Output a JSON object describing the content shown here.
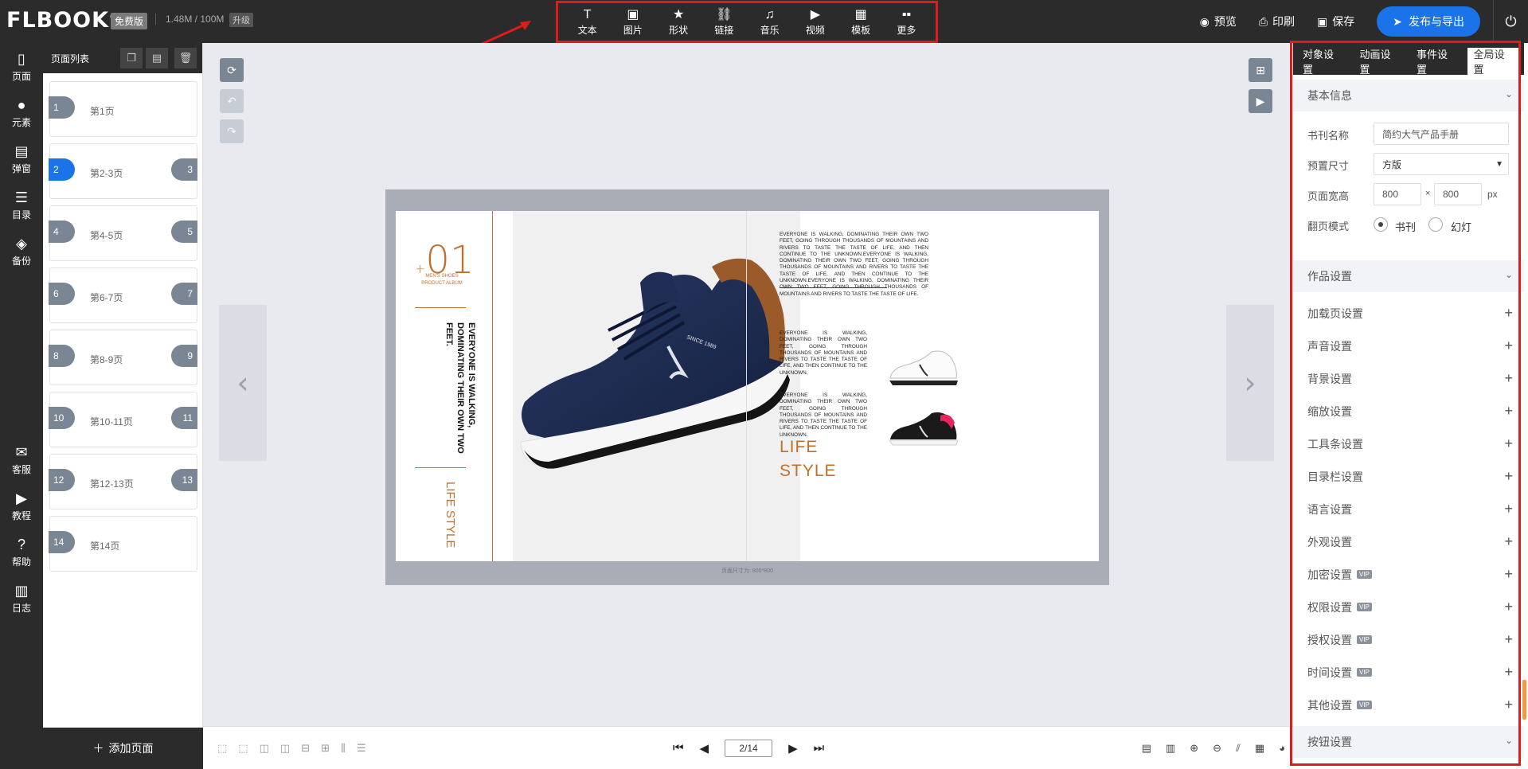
{
  "topbar": {
    "logo": "FLBOOK",
    "logo_mark": "®",
    "plan_badge": "免费版",
    "storage": "1.48M / 100M",
    "upgrade": "升级",
    "tools": [
      {
        "icon": "text-icon",
        "glyph": "T",
        "label": "文本"
      },
      {
        "icon": "image-icon",
        "glyph": "▣",
        "label": "图片"
      },
      {
        "icon": "star-icon",
        "glyph": "★",
        "label": "形状"
      },
      {
        "icon": "link-icon",
        "glyph": "⛓",
        "label": "链接"
      },
      {
        "icon": "music-icon",
        "glyph": "♫",
        "label": "音乐"
      },
      {
        "icon": "play-icon",
        "glyph": "▶",
        "label": "视频"
      },
      {
        "icon": "template-icon",
        "glyph": "▦",
        "label": "模板"
      },
      {
        "icon": "more-icon",
        "glyph": "▪▪",
        "label": "更多"
      }
    ],
    "preview": "预览",
    "print": "印刷",
    "save": "保存",
    "publish": "发布与导出"
  },
  "leftnav": [
    {
      "icon": "page-icon",
      "glyph": "▯",
      "label": "页面"
    },
    {
      "icon": "elements-icon",
      "glyph": "●",
      "label": "元素"
    },
    {
      "icon": "popup-icon",
      "glyph": "▤",
      "label": "弹窗"
    },
    {
      "icon": "toc-icon",
      "glyph": "☰",
      "label": "目录"
    },
    {
      "icon": "backup-icon",
      "glyph": "◈",
      "label": "备份"
    },
    {
      "icon": "service-icon",
      "glyph": "✉",
      "label": "客服"
    },
    {
      "icon": "tutorial-icon",
      "glyph": "▶",
      "label": "教程"
    },
    {
      "icon": "help-icon",
      "glyph": "?",
      "label": "帮助"
    },
    {
      "icon": "log-icon",
      "glyph": "▥",
      "label": "日志"
    }
  ],
  "pagelist": {
    "title": "页面列表",
    "items": [
      {
        "n1": "1",
        "n2": "",
        "label": "第1页",
        "active": false
      },
      {
        "n1": "2",
        "n2": "3",
        "label": "第2-3页",
        "active": true
      },
      {
        "n1": "4",
        "n2": "5",
        "label": "第4-5页",
        "active": false
      },
      {
        "n1": "6",
        "n2": "7",
        "label": "第6-7页",
        "active": false
      },
      {
        "n1": "8",
        "n2": "9",
        "label": "第8-9页",
        "active": false
      },
      {
        "n1": "10",
        "n2": "11",
        "label": "第10-11页",
        "active": false
      },
      {
        "n1": "12",
        "n2": "13",
        "label": "第12-13页",
        "active": false
      },
      {
        "n1": "14",
        "n2": "",
        "label": "第14页",
        "active": false
      }
    ],
    "add_page": "添加页面"
  },
  "book": {
    "number": "01",
    "number_prefix": "+",
    "small": "MEN'S SHOES PRODUCT ALBUM",
    "vertical_text": "EVERYONE IS WALKING, DOMINATING THEIR OWN TWO FEET.",
    "vertical_life": "LIFE STYLE",
    "para1": "EVERYONE IS WALKING, DOMINATING THEIR OWN TWO FEET, GOING THROUGH THOUSANDS OF MOUNTAINS AND RIVERS TO TASTE THE TASTE OF LIFE, AND THEN CONTINUE TO THE UNKNOWN.EVERYONE IS WALKING, DOMINATING THEIR OWN TWO FEET, GOING THROUGH THOUSANDS OF MOUNTAINS AND RIVERS TO TASTE THE TASTE OF LIFE, AND THEN CONTINUE TO THE UNKNOWN.EVERYONE IS WALKING, DOMINATING THEIR OWN TWO FEET, GOING THROUGH THOUSANDS OF MOUNTAINS AND RIVERS TO TASTE THE TASTE OF LIFE.",
    "para2": "EVERYONE IS WALKING, DOMINATING THEIR OWN TWO FEET, GOING THROUGH THOUSANDS OF MOUNTAINS AND RIVERS TO TASTE THE TASTE OF LIFE, AND THEN CONTINUE TO THE UNKNOWN.",
    "para3": "EVERYONE IS WALKING, DOMINATING THEIR OWN TWO FEET, GOING THROUGH THOUSANDS OF MOUNTAINS AND RIVERS TO TASTE THE TASTE OF LIFE, AND THEN CONTINUE TO THE UNKNOWN.",
    "life_style": "LIFE STYLE",
    "shoe_text": "SINCE 1989",
    "dimension_label": "页面尺寸为: 800*800"
  },
  "pager": {
    "current": "2/14"
  },
  "rpanel": {
    "tabs": [
      "对象设置",
      "动画设置",
      "事件设置",
      "全局设置"
    ],
    "basic_info": "基本信息",
    "name_label": "书刊名称",
    "name_placeholder": "简约大气产品手册",
    "size_label": "预置尺寸",
    "size_value": "方版",
    "wh_label": "页面宽高",
    "width": "800",
    "height": "800",
    "times": "×",
    "unit": "px",
    "flip_label": "翻页模式",
    "flip_book": "书刊",
    "flip_slide": "幻灯",
    "work_settings": "作品设置",
    "rows": [
      {
        "label": "加载页设置",
        "vip": false
      },
      {
        "label": "声音设置",
        "vip": false
      },
      {
        "label": "背景设置",
        "vip": false
      },
      {
        "label": "缩放设置",
        "vip": false
      },
      {
        "label": "工具条设置",
        "vip": false
      },
      {
        "label": "目录栏设置",
        "vip": false
      },
      {
        "label": "语言设置",
        "vip": false
      },
      {
        "label": "外观设置",
        "vip": false
      },
      {
        "label": "加密设置",
        "vip": true
      },
      {
        "label": "权限设置",
        "vip": true
      },
      {
        "label": "授权设置",
        "vip": true
      },
      {
        "label": "时间设置",
        "vip": true
      },
      {
        "label": "其他设置",
        "vip": true
      }
    ],
    "vip_text": "VIP",
    "button_settings": "按钮设置"
  },
  "colors": {
    "accent": "#1a73e8",
    "highlight": "#e01b1b",
    "brown": "#c0702e"
  }
}
